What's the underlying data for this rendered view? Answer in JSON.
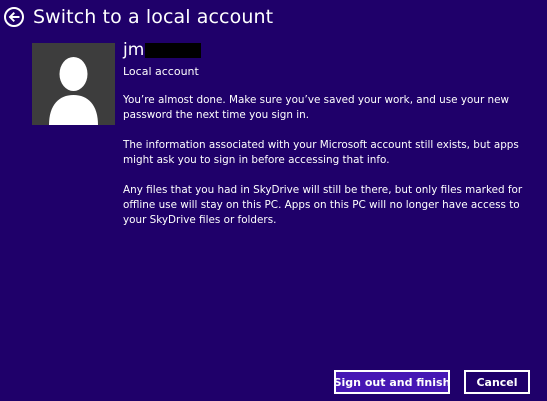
{
  "header": {
    "title": "Switch to a local account",
    "back_icon": "back-arrow-icon"
  },
  "account": {
    "username": "jm",
    "type": "Local account",
    "avatar_icon": "user-silhouette-icon"
  },
  "message": {
    "paragraphs": [
      "You’re almost done. Make sure you’ve saved your work, and use your new password the next time you sign in.",
      "The information associated with your Microsoft account still exists, but apps might ask you to sign in before accessing that info.",
      "Any files that you had in SkyDrive will still be there, but only files marked for offline use will stay on this PC. Apps on this PC will no longer have access to your SkyDrive files or folders."
    ]
  },
  "buttons": {
    "primary_label": "Sign out and finish",
    "secondary_label": "Cancel"
  },
  "colors": {
    "background": "#1f006a",
    "primary_button": "#4617b4",
    "text": "#ffffff",
    "avatar_bg": "#3d3d3d"
  }
}
